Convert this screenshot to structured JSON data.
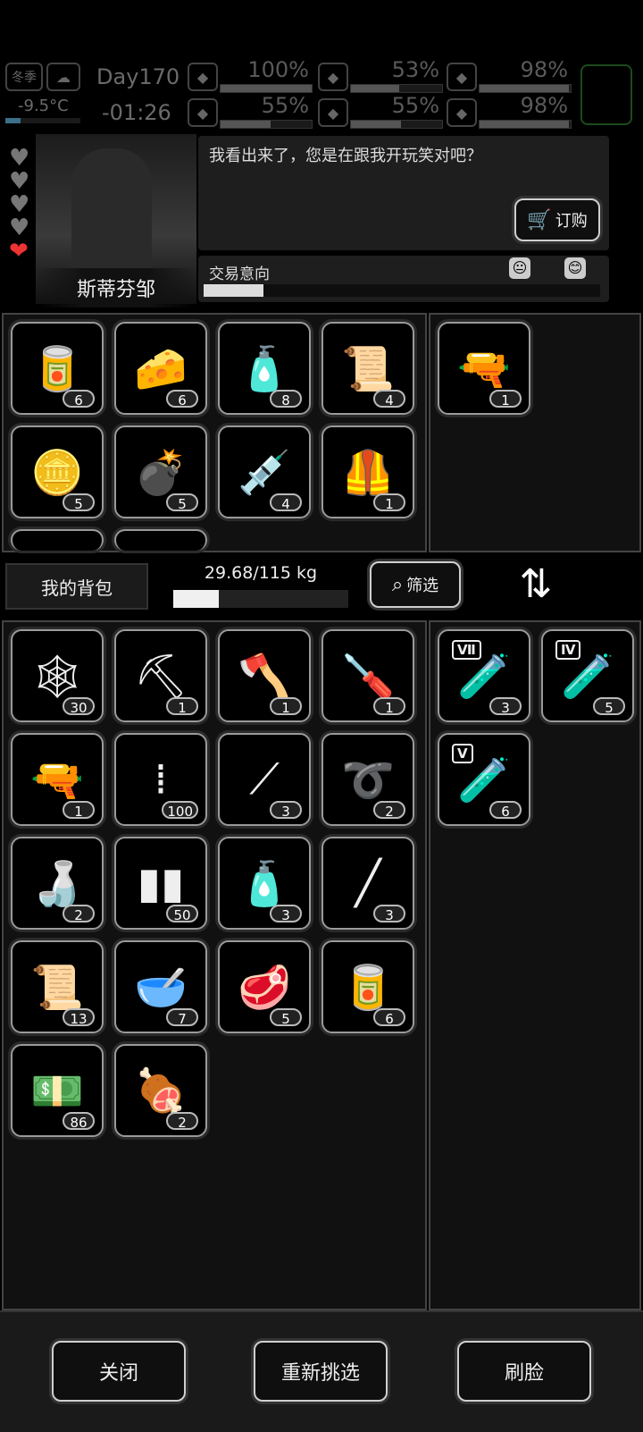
{
  "status": {
    "season": "冬季",
    "temperature": "-9.5°C",
    "day": "Day170",
    "time": "-01:26",
    "stats": [
      {
        "icon": "health-icon",
        "value": "100%",
        "fill": 1.0
      },
      {
        "icon": "stomach-icon",
        "value": "53%",
        "fill": 0.53
      },
      {
        "icon": "backpack-status-icon",
        "value": "98%",
        "fill": 0.98
      },
      {
        "icon": "flask-icon",
        "value": "55%",
        "fill": 0.55
      },
      {
        "icon": "water-drop-icon",
        "value": "55%",
        "fill": 0.55
      },
      {
        "icon": "heart-status-icon",
        "value": "98%",
        "fill": 0.98
      }
    ]
  },
  "npc": {
    "name": "斯蒂芬邹",
    "hearts_total": 5,
    "hearts_filled": 1,
    "dialog": "我看出来了，您是在跟我开玩笑对吧？",
    "order_button": "订购",
    "trade_intent_label": "交易意向",
    "trade_intent": 0.15
  },
  "trader_inventory": [
    {
      "icon": "canned-food-icon",
      "glyph": "🥫",
      "count": "6"
    },
    {
      "icon": "cheese-icon",
      "glyph": "🧀",
      "count": "6"
    },
    {
      "icon": "spray-cans-icon",
      "glyph": "🧴",
      "count": "8"
    },
    {
      "icon": "bandage-roll-icon",
      "glyph": "📜",
      "count": "4"
    },
    {
      "icon": "gold-bars-icon",
      "glyph": "🪙",
      "count": "5"
    },
    {
      "icon": "grenade-icon",
      "glyph": "💣",
      "count": "5"
    },
    {
      "icon": "syringe-icon",
      "glyph": "💉",
      "count": "4"
    },
    {
      "icon": "body-armor-icon",
      "glyph": "🦺",
      "count": "1"
    }
  ],
  "trader_offer": [
    {
      "icon": "sniper-rifle-icon",
      "glyph": "🔫",
      "count": "1"
    }
  ],
  "backpack": {
    "label": "我的背包",
    "weight": "29.68/115 kg",
    "weight_fill": 0.26,
    "filter_label": "筛选"
  },
  "my_inventory": [
    {
      "icon": "net-icon",
      "glyph": "🕸",
      "count": "30"
    },
    {
      "icon": "shovel-icon",
      "glyph": "⛏",
      "count": "1"
    },
    {
      "icon": "axe-icon",
      "glyph": "🪓",
      "count": "1"
    },
    {
      "icon": "screwdriver-icon",
      "glyph": "🪛",
      "count": "1"
    },
    {
      "icon": "pistol-icon",
      "glyph": "🔫",
      "count": "1"
    },
    {
      "icon": "rifle-ammo-icon",
      "glyph": "⁞",
      "count": "100"
    },
    {
      "icon": "lockpicks-icon",
      "glyph": "⟋",
      "count": "3"
    },
    {
      "icon": "rope-icon",
      "glyph": "➰",
      "count": "2"
    },
    {
      "icon": "water-bottle-icon",
      "glyph": "🍶",
      "count": "2"
    },
    {
      "icon": "pistol-ammo-icon",
      "glyph": "▮▮",
      "count": "50"
    },
    {
      "icon": "spray-cans-icon",
      "glyph": "🧴",
      "count": "3"
    },
    {
      "icon": "baton-icon",
      "glyph": "╱",
      "count": "3"
    },
    {
      "icon": "bandage-roll-icon",
      "glyph": "📜",
      "count": "13"
    },
    {
      "icon": "soup-bowl-icon",
      "glyph": "🥣",
      "count": "7"
    },
    {
      "icon": "meat-slice-icon",
      "glyph": "🥩",
      "count": "5"
    },
    {
      "icon": "canned-food-icon",
      "glyph": "🥫",
      "count": "6"
    },
    {
      "icon": "cash-stack-icon",
      "glyph": "💵",
      "count": "86"
    },
    {
      "icon": "raw-meat-icon",
      "glyph": "🍖",
      "count": "2"
    }
  ],
  "my_offer": [
    {
      "icon": "test-tube-icon",
      "roman": "Ⅶ",
      "count": "3"
    },
    {
      "icon": "test-tube-icon",
      "roman": "Ⅳ",
      "count": "5"
    },
    {
      "icon": "test-tube-icon",
      "roman": "Ⅴ",
      "count": "6"
    }
  ],
  "buttons": {
    "close": "关闭",
    "reselect": "重新挑选",
    "face": "刷脸"
  }
}
